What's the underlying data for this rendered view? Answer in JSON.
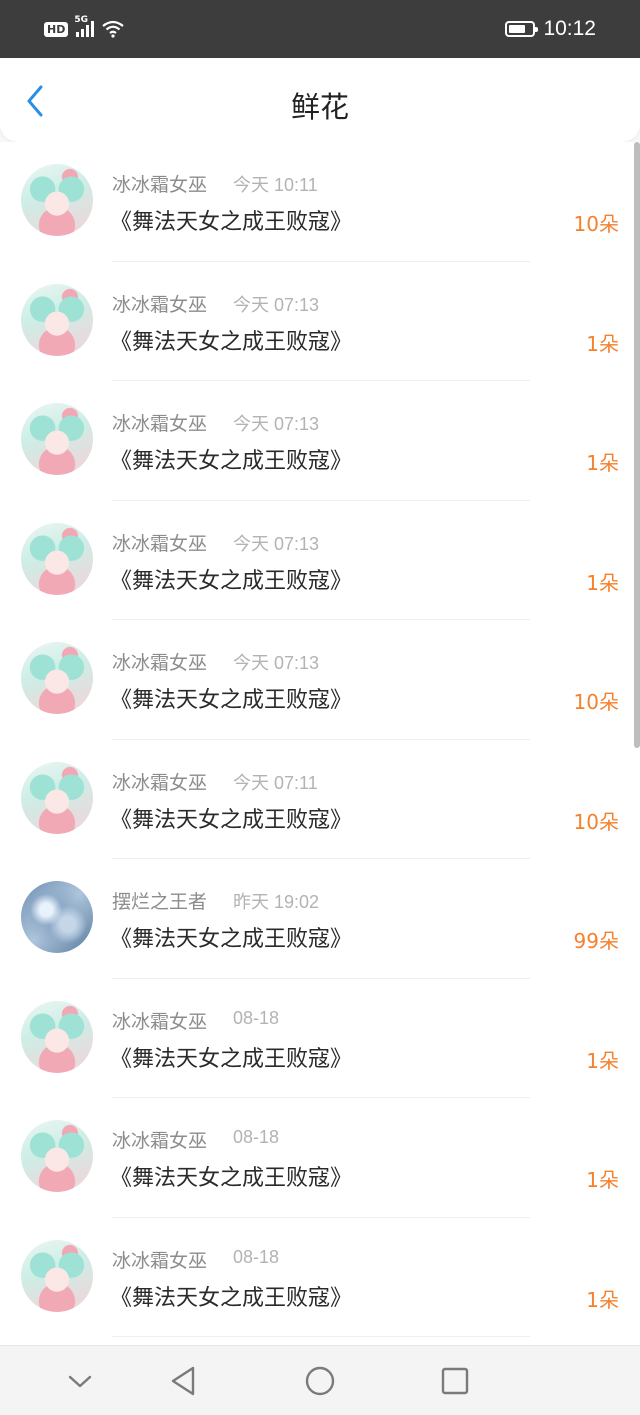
{
  "status_bar": {
    "hd": "HD",
    "network": "5G",
    "time": "10:12"
  },
  "header": {
    "title": "鲜花"
  },
  "items": [
    {
      "name": "冰冰霜女巫",
      "time": "今天 10:11",
      "book": "《舞法天女之成王败寇》",
      "amount": "10朵",
      "avatar": "avatar-a"
    },
    {
      "name": "冰冰霜女巫",
      "time": "今天 07:13",
      "book": "《舞法天女之成王败寇》",
      "amount": "1朵",
      "avatar": "avatar-a"
    },
    {
      "name": "冰冰霜女巫",
      "time": "今天 07:13",
      "book": "《舞法天女之成王败寇》",
      "amount": "1朵",
      "avatar": "avatar-a"
    },
    {
      "name": "冰冰霜女巫",
      "time": "今天 07:13",
      "book": "《舞法天女之成王败寇》",
      "amount": "1朵",
      "avatar": "avatar-a"
    },
    {
      "name": "冰冰霜女巫",
      "time": "今天 07:13",
      "book": "《舞法天女之成王败寇》",
      "amount": "10朵",
      "avatar": "avatar-a"
    },
    {
      "name": "冰冰霜女巫",
      "time": "今天 07:11",
      "book": "《舞法天女之成王败寇》",
      "amount": "10朵",
      "avatar": "avatar-a"
    },
    {
      "name": "摆烂之王者",
      "time": "昨天 19:02",
      "book": "《舞法天女之成王败寇》",
      "amount": "99朵",
      "avatar": "avatar-b"
    },
    {
      "name": "冰冰霜女巫",
      "time": "08-18",
      "book": "《舞法天女之成王败寇》",
      "amount": "1朵",
      "avatar": "avatar-a"
    },
    {
      "name": "冰冰霜女巫",
      "time": "08-18",
      "book": "《舞法天女之成王败寇》",
      "amount": "1朵",
      "avatar": "avatar-a"
    },
    {
      "name": "冰冰霜女巫",
      "time": "08-18",
      "book": "《舞法天女之成王败寇》",
      "amount": "1朵",
      "avatar": "avatar-a"
    }
  ],
  "colors": {
    "accent": "#f5812d",
    "back_icon": "#2b8fe6"
  },
  "navbar": {
    "icons": [
      "chevron-down-icon",
      "back-triangle-icon",
      "home-circle-icon",
      "recents-square-icon"
    ]
  }
}
